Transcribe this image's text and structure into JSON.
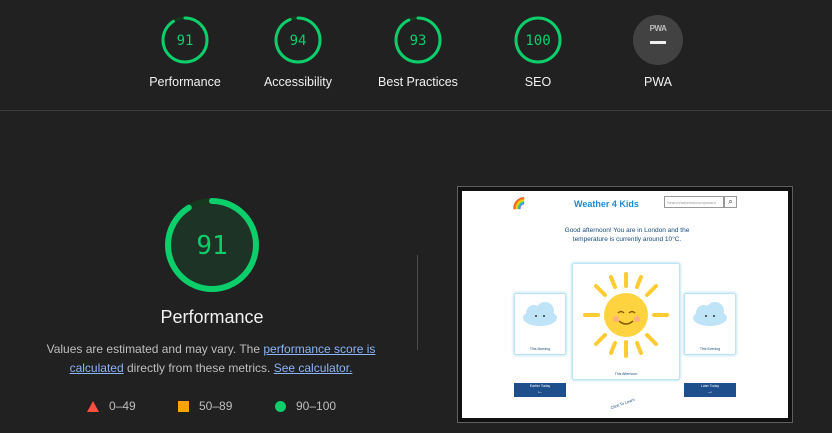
{
  "colors": {
    "pass": "#0cce6b",
    "average": "#ffa400",
    "fail": "#ff4e42",
    "link": "#8ab4f8",
    "background": "#212121"
  },
  "categories": [
    {
      "label": "Performance",
      "score": "91",
      "score_value": 91
    },
    {
      "label": "Accessibility",
      "score": "94",
      "score_value": 94
    },
    {
      "label": "Best Practices",
      "score": "93",
      "score_value": 93
    },
    {
      "label": "SEO",
      "score": "100",
      "score_value": 100
    },
    {
      "label": "PWA",
      "badge_text": "PWA",
      "icon": "pwa-badge-icon"
    }
  ],
  "performance": {
    "score": "91",
    "score_value": 91,
    "title": "Performance",
    "desc_prefix": "Values are estimated and may vary. The ",
    "desc_link1": "performance score is calculated",
    "desc_middle": " directly from these metrics. ",
    "desc_link2": "See calculator.",
    "legend": [
      {
        "range": "0–49",
        "icon": "fail-triangle-icon"
      },
      {
        "range": "50–89",
        "icon": "average-square-icon"
      },
      {
        "range": "90–100",
        "icon": "pass-circle-icon"
      }
    ]
  },
  "screenshot": {
    "site_title": "Weather 4 Kids",
    "search_placeholder": "Search/address/composant",
    "greeting": "Good afternoon! You are in London and the temperature is currently around 10°C.",
    "left_card_label": "This Morning",
    "center_card_label": "This Afternoon",
    "right_card_label": "This Evening",
    "left_button": "Earlier Today",
    "right_button": "Later Today",
    "click_to_learn": "Click To Learn"
  }
}
